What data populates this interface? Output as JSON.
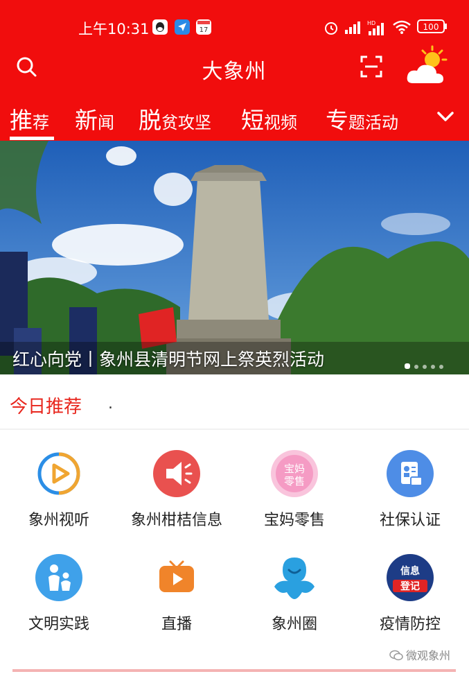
{
  "status_bar": {
    "time": "上午10:31",
    "icons": [
      "qq-icon",
      "location-icon",
      "calendar-icon",
      "alarm-icon",
      "signal-icon",
      "hd-signal-icon",
      "wifi-icon",
      "battery-icon"
    ],
    "calendar_day": "17",
    "battery": "100"
  },
  "header": {
    "title": "大象州",
    "left_icon": "search-icon",
    "right_icon": "scan-icon",
    "weather_icon": "sun-cloud-icon",
    "color": "#f10d0d"
  },
  "tabs": [
    {
      "big": "推",
      "small": "荐",
      "active": true
    },
    {
      "big": "新",
      "small": "闻",
      "active": false
    },
    {
      "big": "脱",
      "small": "贫攻坚",
      "active": false
    },
    {
      "big": "短",
      "small": "视频",
      "active": false
    },
    {
      "big": "专",
      "small": "题活动",
      "active": false
    }
  ],
  "banner": {
    "caption": "红心向党丨象州县清明节网上祭英烈活动",
    "dot_count": 5,
    "active_dot": 0
  },
  "today": {
    "title": "今日推荐",
    "dot": "."
  },
  "grid": [
    {
      "label": "象州视听",
      "icon": "play-circle-icon",
      "color": "#e9a43a"
    },
    {
      "label": "象州柑桔信息",
      "icon": "speaker-icon",
      "color": "#e9514f"
    },
    {
      "label": "宝妈零售",
      "icon": "baoma-icon",
      "color": "#f5a3c7",
      "badge": "宝妈零售"
    },
    {
      "label": "社保认证",
      "icon": "id-card-icon",
      "color": "#4e8de6"
    },
    {
      "label": "文明实践",
      "icon": "family-icon",
      "color": "#3fa1ea"
    },
    {
      "label": "直播",
      "icon": "tv-live-icon",
      "color": "#f0842a"
    },
    {
      "label": "象州圈",
      "icon": "circle-people-icon",
      "color": "#2aa0e0"
    },
    {
      "label": "疫情防控",
      "icon": "info-register-icon",
      "color": "#1d3c86",
      "badge_top": "信息",
      "badge_bottom": "登记"
    }
  ],
  "watermark": "微观象州"
}
